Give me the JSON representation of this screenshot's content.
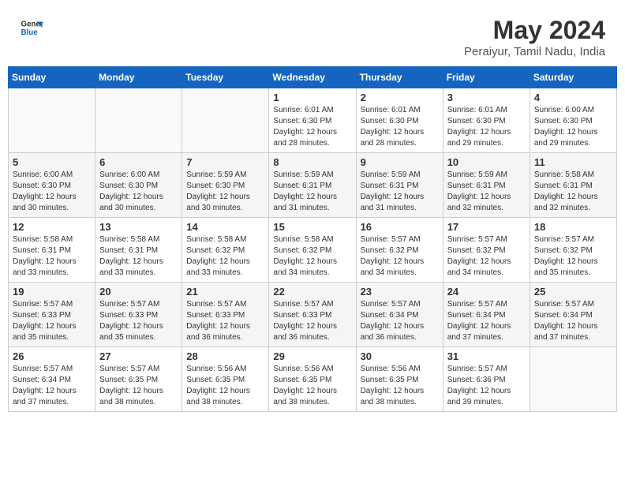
{
  "header": {
    "logo_line1": "General",
    "logo_line2": "Blue",
    "month_year": "May 2024",
    "location": "Peraiyur, Tamil Nadu, India"
  },
  "days_of_week": [
    "Sunday",
    "Monday",
    "Tuesday",
    "Wednesday",
    "Thursday",
    "Friday",
    "Saturday"
  ],
  "weeks": [
    [
      {
        "day": "",
        "sunrise": "",
        "sunset": "",
        "daylight": ""
      },
      {
        "day": "",
        "sunrise": "",
        "sunset": "",
        "daylight": ""
      },
      {
        "day": "",
        "sunrise": "",
        "sunset": "",
        "daylight": ""
      },
      {
        "day": "1",
        "sunrise": "Sunrise: 6:01 AM",
        "sunset": "Sunset: 6:30 PM",
        "daylight": "Daylight: 12 hours and 28 minutes."
      },
      {
        "day": "2",
        "sunrise": "Sunrise: 6:01 AM",
        "sunset": "Sunset: 6:30 PM",
        "daylight": "Daylight: 12 hours and 28 minutes."
      },
      {
        "day": "3",
        "sunrise": "Sunrise: 6:01 AM",
        "sunset": "Sunset: 6:30 PM",
        "daylight": "Daylight: 12 hours and 29 minutes."
      },
      {
        "day": "4",
        "sunrise": "Sunrise: 6:00 AM",
        "sunset": "Sunset: 6:30 PM",
        "daylight": "Daylight: 12 hours and 29 minutes."
      }
    ],
    [
      {
        "day": "5",
        "sunrise": "Sunrise: 6:00 AM",
        "sunset": "Sunset: 6:30 PM",
        "daylight": "Daylight: 12 hours and 30 minutes."
      },
      {
        "day": "6",
        "sunrise": "Sunrise: 6:00 AM",
        "sunset": "Sunset: 6:30 PM",
        "daylight": "Daylight: 12 hours and 30 minutes."
      },
      {
        "day": "7",
        "sunrise": "Sunrise: 5:59 AM",
        "sunset": "Sunset: 6:30 PM",
        "daylight": "Daylight: 12 hours and 30 minutes."
      },
      {
        "day": "8",
        "sunrise": "Sunrise: 5:59 AM",
        "sunset": "Sunset: 6:31 PM",
        "daylight": "Daylight: 12 hours and 31 minutes."
      },
      {
        "day": "9",
        "sunrise": "Sunrise: 5:59 AM",
        "sunset": "Sunset: 6:31 PM",
        "daylight": "Daylight: 12 hours and 31 minutes."
      },
      {
        "day": "10",
        "sunrise": "Sunrise: 5:59 AM",
        "sunset": "Sunset: 6:31 PM",
        "daylight": "Daylight: 12 hours and 32 minutes."
      },
      {
        "day": "11",
        "sunrise": "Sunrise: 5:58 AM",
        "sunset": "Sunset: 6:31 PM",
        "daylight": "Daylight: 12 hours and 32 minutes."
      }
    ],
    [
      {
        "day": "12",
        "sunrise": "Sunrise: 5:58 AM",
        "sunset": "Sunset: 6:31 PM",
        "daylight": "Daylight: 12 hours and 33 minutes."
      },
      {
        "day": "13",
        "sunrise": "Sunrise: 5:58 AM",
        "sunset": "Sunset: 6:31 PM",
        "daylight": "Daylight: 12 hours and 33 minutes."
      },
      {
        "day": "14",
        "sunrise": "Sunrise: 5:58 AM",
        "sunset": "Sunset: 6:32 PM",
        "daylight": "Daylight: 12 hours and 33 minutes."
      },
      {
        "day": "15",
        "sunrise": "Sunrise: 5:58 AM",
        "sunset": "Sunset: 6:32 PM",
        "daylight": "Daylight: 12 hours and 34 minutes."
      },
      {
        "day": "16",
        "sunrise": "Sunrise: 5:57 AM",
        "sunset": "Sunset: 6:32 PM",
        "daylight": "Daylight: 12 hours and 34 minutes."
      },
      {
        "day": "17",
        "sunrise": "Sunrise: 5:57 AM",
        "sunset": "Sunset: 6:32 PM",
        "daylight": "Daylight: 12 hours and 34 minutes."
      },
      {
        "day": "18",
        "sunrise": "Sunrise: 5:57 AM",
        "sunset": "Sunset: 6:32 PM",
        "daylight": "Daylight: 12 hours and 35 minutes."
      }
    ],
    [
      {
        "day": "19",
        "sunrise": "Sunrise: 5:57 AM",
        "sunset": "Sunset: 6:33 PM",
        "daylight": "Daylight: 12 hours and 35 minutes."
      },
      {
        "day": "20",
        "sunrise": "Sunrise: 5:57 AM",
        "sunset": "Sunset: 6:33 PM",
        "daylight": "Daylight: 12 hours and 35 minutes."
      },
      {
        "day": "21",
        "sunrise": "Sunrise: 5:57 AM",
        "sunset": "Sunset: 6:33 PM",
        "daylight": "Daylight: 12 hours and 36 minutes."
      },
      {
        "day": "22",
        "sunrise": "Sunrise: 5:57 AM",
        "sunset": "Sunset: 6:33 PM",
        "daylight": "Daylight: 12 hours and 36 minutes."
      },
      {
        "day": "23",
        "sunrise": "Sunrise: 5:57 AM",
        "sunset": "Sunset: 6:34 PM",
        "daylight": "Daylight: 12 hours and 36 minutes."
      },
      {
        "day": "24",
        "sunrise": "Sunrise: 5:57 AM",
        "sunset": "Sunset: 6:34 PM",
        "daylight": "Daylight: 12 hours and 37 minutes."
      },
      {
        "day": "25",
        "sunrise": "Sunrise: 5:57 AM",
        "sunset": "Sunset: 6:34 PM",
        "daylight": "Daylight: 12 hours and 37 minutes."
      }
    ],
    [
      {
        "day": "26",
        "sunrise": "Sunrise: 5:57 AM",
        "sunset": "Sunset: 6:34 PM",
        "daylight": "Daylight: 12 hours and 37 minutes."
      },
      {
        "day": "27",
        "sunrise": "Sunrise: 5:57 AM",
        "sunset": "Sunset: 6:35 PM",
        "daylight": "Daylight: 12 hours and 38 minutes."
      },
      {
        "day": "28",
        "sunrise": "Sunrise: 5:56 AM",
        "sunset": "Sunset: 6:35 PM",
        "daylight": "Daylight: 12 hours and 38 minutes."
      },
      {
        "day": "29",
        "sunrise": "Sunrise: 5:56 AM",
        "sunset": "Sunset: 6:35 PM",
        "daylight": "Daylight: 12 hours and 38 minutes."
      },
      {
        "day": "30",
        "sunrise": "Sunrise: 5:56 AM",
        "sunset": "Sunset: 6:35 PM",
        "daylight": "Daylight: 12 hours and 38 minutes."
      },
      {
        "day": "31",
        "sunrise": "Sunrise: 5:57 AM",
        "sunset": "Sunset: 6:36 PM",
        "daylight": "Daylight: 12 hours and 39 minutes."
      },
      {
        "day": "",
        "sunrise": "",
        "sunset": "",
        "daylight": ""
      }
    ]
  ]
}
